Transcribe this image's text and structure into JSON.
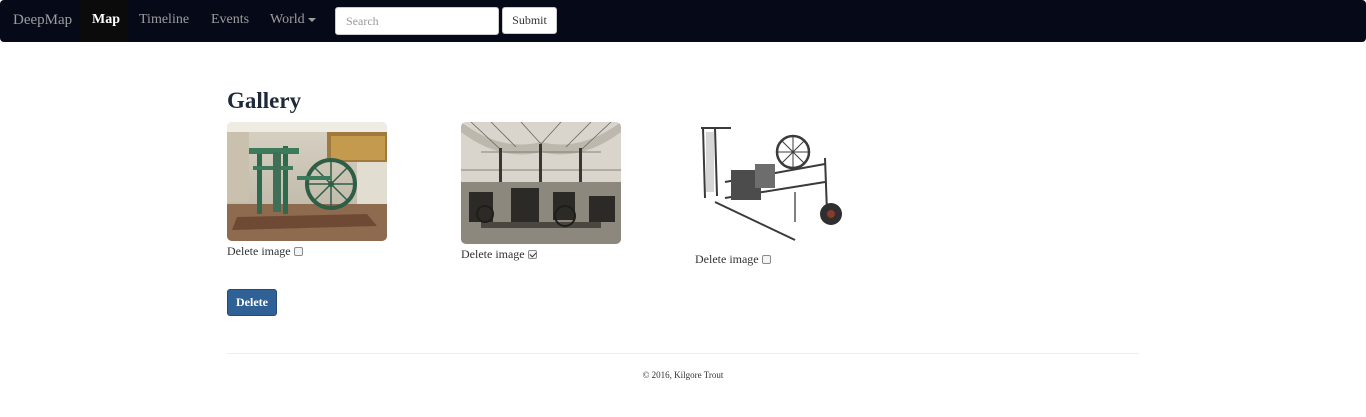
{
  "navbar": {
    "brand": "DeepMap",
    "items": [
      {
        "label": "Map",
        "active": true
      },
      {
        "label": "Timeline"
      },
      {
        "label": "Events"
      },
      {
        "label": "World",
        "dropdown": true
      }
    ],
    "search": {
      "placeholder": "Search",
      "value": ""
    },
    "submit_label": "Submit"
  },
  "gallery": {
    "title": "Gallery",
    "images": [
      {
        "subject": "steam-engine-museum",
        "delete_label": "Delete image",
        "checked": false
      },
      {
        "subject": "textile-mill-engraving",
        "delete_label": "Delete image",
        "checked": true
      },
      {
        "subject": "spinning-mule-machine",
        "delete_label": "Delete image",
        "checked": false
      }
    ],
    "delete_button": "Delete"
  },
  "footer": {
    "text": "© 2016, Kilgore Trout"
  },
  "colors": {
    "navbar_bg": "#060a18",
    "button_primary": "#2f6096"
  }
}
